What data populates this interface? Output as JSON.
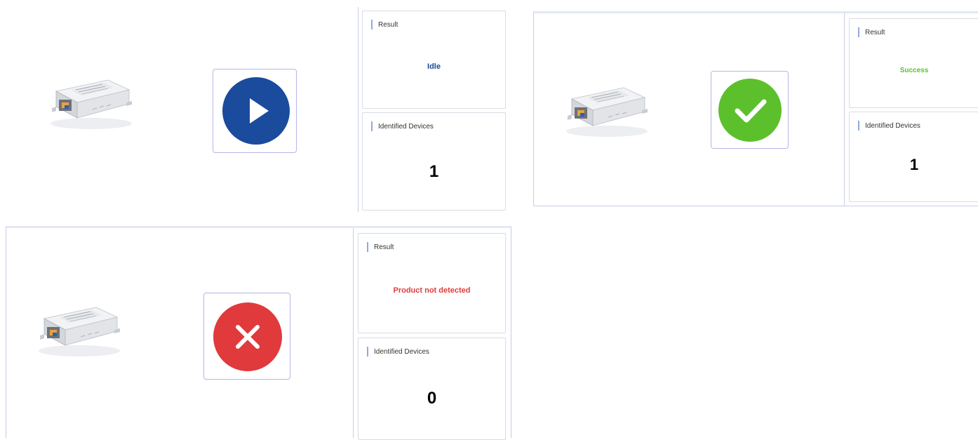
{
  "colors": {
    "idle": "#1a4b9c",
    "success": "#5cc02c",
    "error": "#e03a3c",
    "card_header_bar": "#8faadc",
    "button_border": "#b8b5e6"
  },
  "panels": [
    {
      "state": "idle",
      "device_image": "led-driver-device",
      "action_icon": "play-icon",
      "result": {
        "label": "Result",
        "value": "Idle"
      },
      "devices": {
        "label": "Identified Devices",
        "value": "1"
      }
    },
    {
      "state": "success",
      "device_image": "led-driver-device",
      "action_icon": "checkmark-icon",
      "result": {
        "label": "Result",
        "value": "Success"
      },
      "devices": {
        "label": "Identified Devices",
        "value": "1"
      }
    },
    {
      "state": "error",
      "device_image": "led-driver-device",
      "action_icon": "x-icon",
      "result": {
        "label": "Result",
        "value": "Product not detected"
      },
      "devices": {
        "label": "Identified Devices",
        "value": "0"
      }
    }
  ]
}
